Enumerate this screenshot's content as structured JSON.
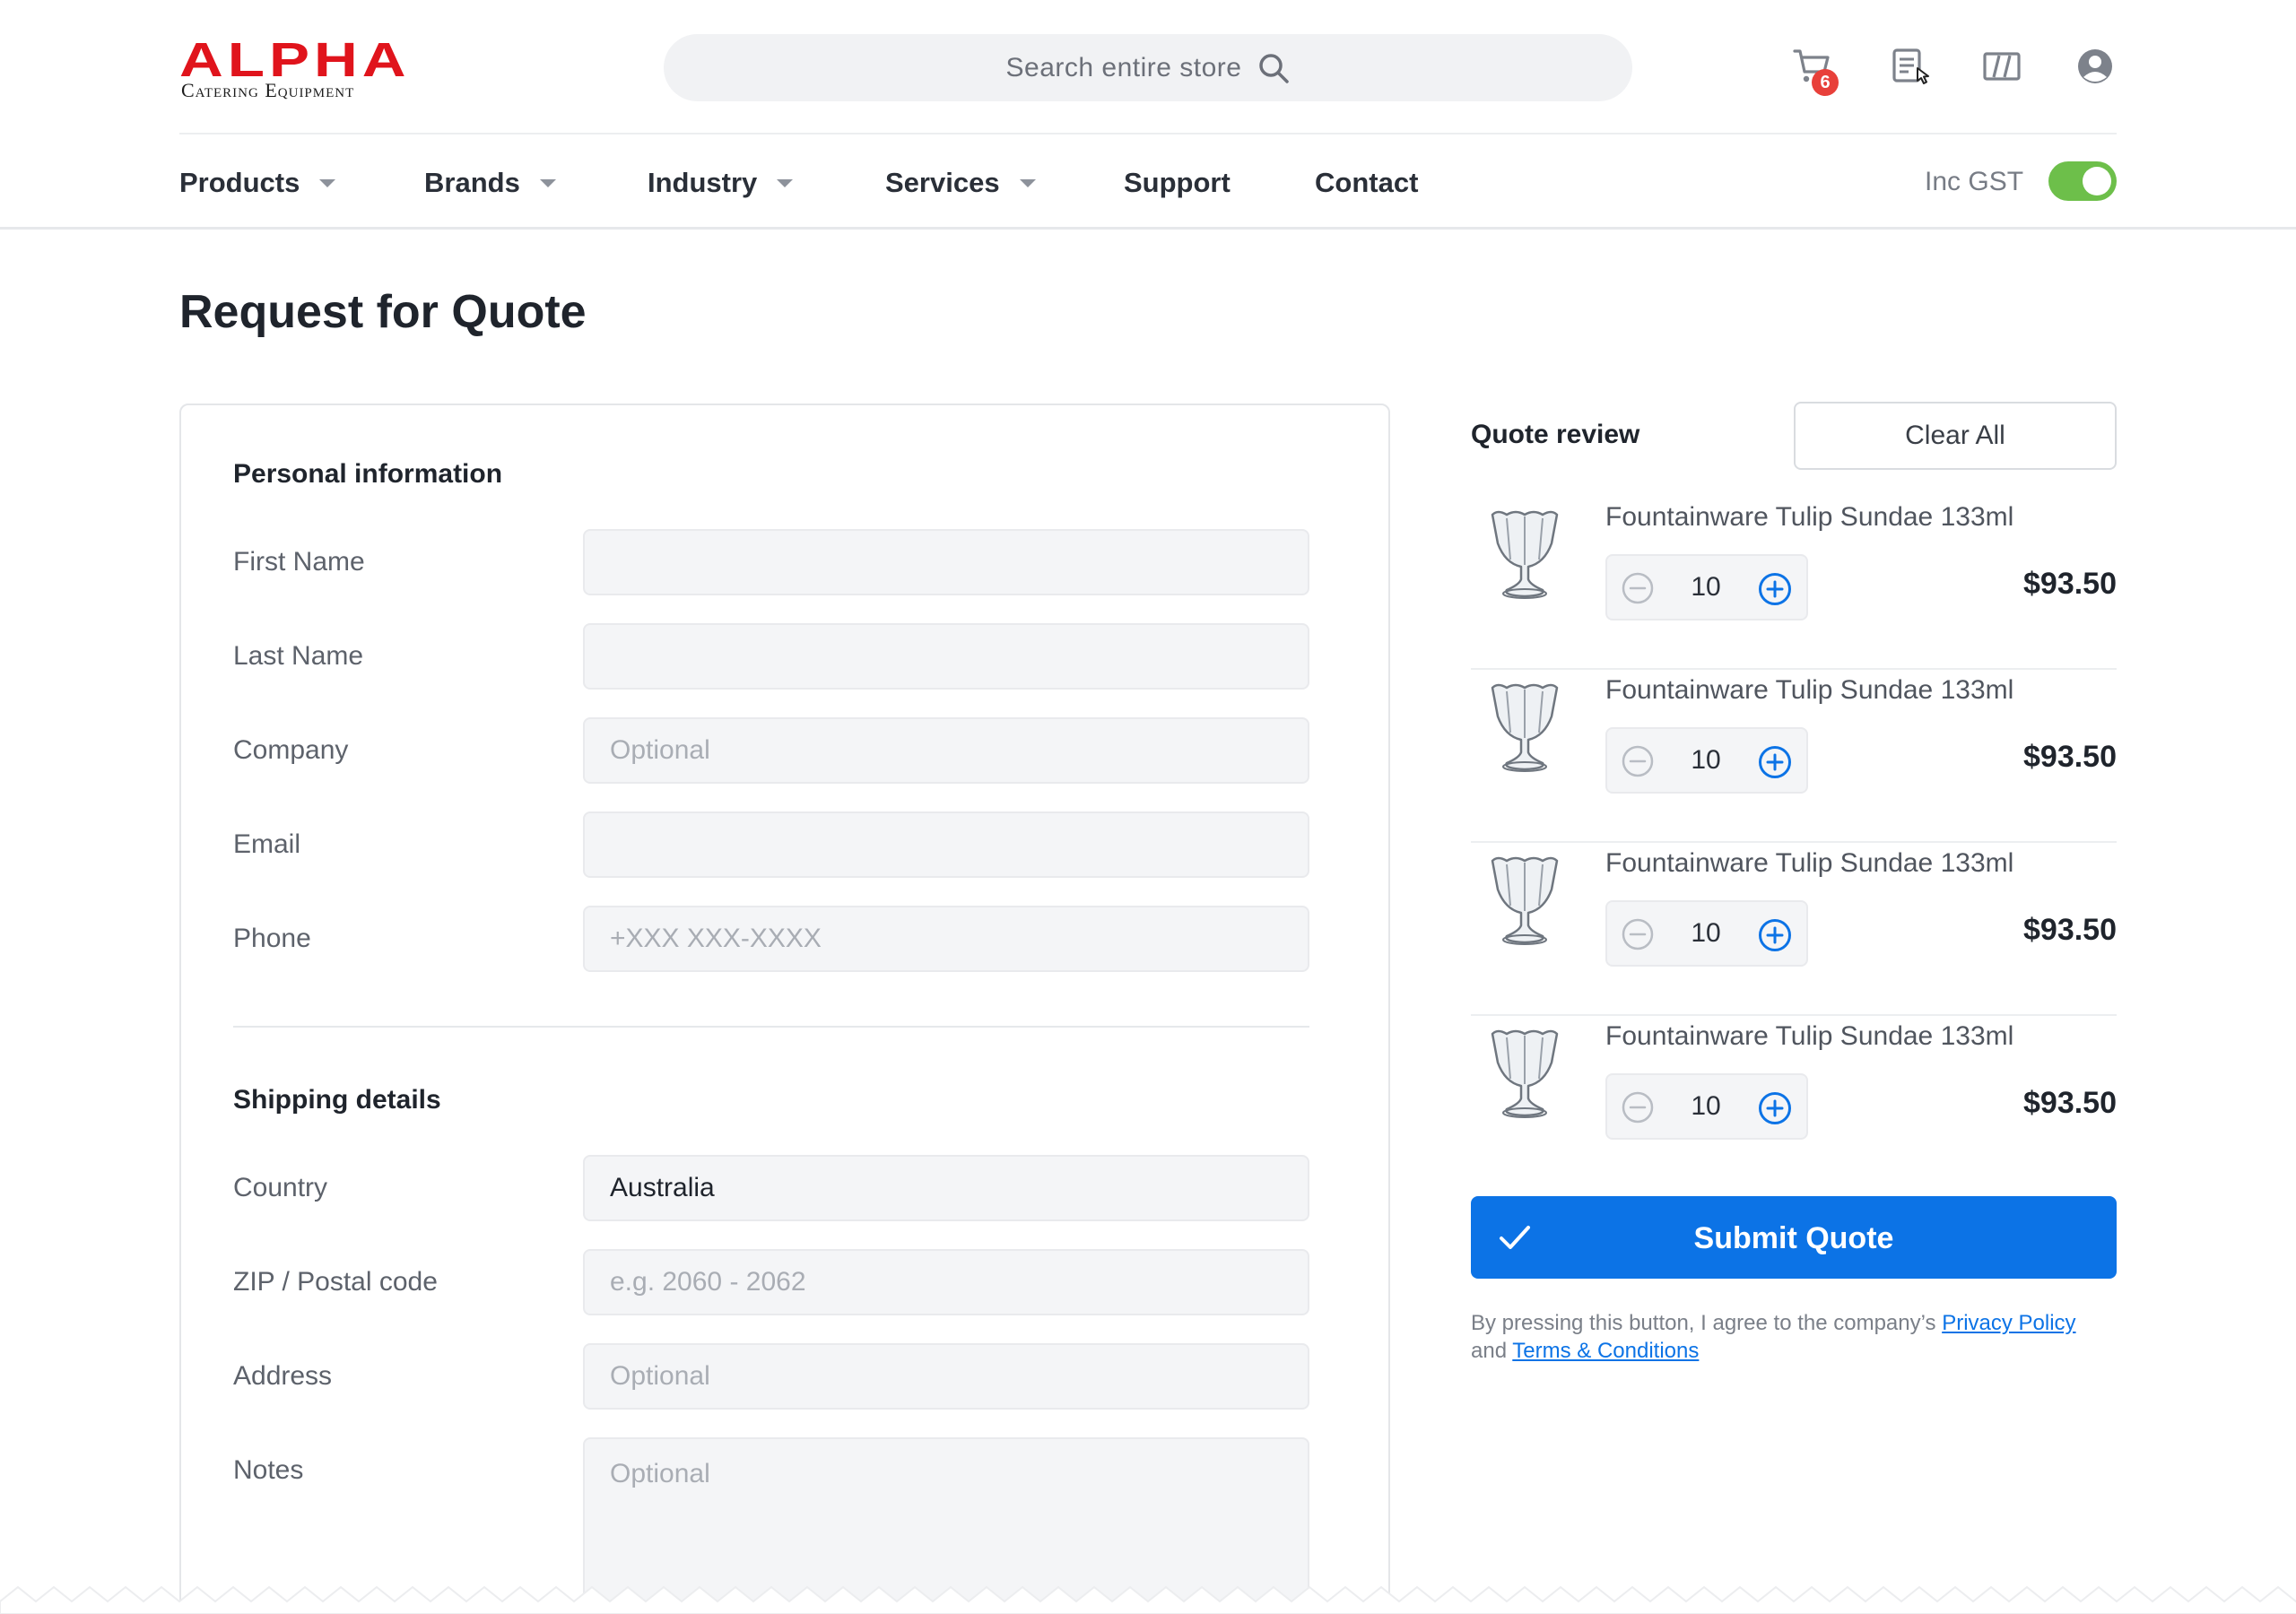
{
  "header": {
    "logo": {
      "title": "ALPHA",
      "subtitle": "Catering Equipment"
    },
    "search": {
      "placeholder": "Search entire store"
    },
    "cart_count": "6",
    "icons": [
      "cart-icon",
      "quote-list-icon",
      "compare-icon",
      "account-icon"
    ],
    "nav": {
      "items": [
        {
          "label": "Products",
          "dropdown": true
        },
        {
          "label": "Brands",
          "dropdown": true
        },
        {
          "label": "Industry",
          "dropdown": true
        },
        {
          "label": "Services",
          "dropdown": true
        },
        {
          "label": "Support",
          "dropdown": false
        },
        {
          "label": "Contact",
          "dropdown": false
        }
      ]
    },
    "gst": {
      "label": "Inc GST",
      "enabled": true
    }
  },
  "page": {
    "title": "Request for Quote"
  },
  "form": {
    "personal": {
      "title": "Personal information",
      "first_name": {
        "label": "First Name",
        "placeholder": "",
        "value": ""
      },
      "last_name": {
        "label": "Last Name",
        "placeholder": "",
        "value": ""
      },
      "company": {
        "label": "Company",
        "placeholder": "Optional",
        "value": ""
      },
      "email": {
        "label": "Email",
        "placeholder": "",
        "value": ""
      },
      "phone": {
        "label": "Phone",
        "placeholder": "+XXX XXX-XXXX",
        "value": ""
      }
    },
    "shipping": {
      "title": "Shipping details",
      "country": {
        "label": "Country",
        "placeholder": "",
        "value": "Australia"
      },
      "zip": {
        "label": "ZIP / Postal code",
        "placeholder": "e.g. 2060 - 2062",
        "value": ""
      },
      "address": {
        "label": "Address",
        "placeholder": "Optional",
        "value": ""
      },
      "notes": {
        "label": "Notes",
        "placeholder": "Optional",
        "value": ""
      }
    }
  },
  "quote": {
    "title": "Quote review",
    "clear_label": "Clear All",
    "items": [
      {
        "name": "Fountainware Tulip Sundae 133ml",
        "qty": "10",
        "price": "$93.50"
      },
      {
        "name": "Fountainware Tulip Sundae 133ml",
        "qty": "10",
        "price": "$93.50"
      },
      {
        "name": "Fountainware Tulip Sundae 133ml",
        "qty": "10",
        "price": "$93.50"
      },
      {
        "name": "Fountainware Tulip Sundae 133ml",
        "qty": "10",
        "price": "$93.50"
      }
    ],
    "submit_label": "Submit Quote",
    "terms": {
      "prefix": "By pressing this button, I agree to the company’s ",
      "privacy": "Privacy Policy",
      "and": " and ",
      "conditions": "Terms & Conditions"
    }
  },
  "colors": {
    "brand_red": "#e0141c",
    "accent_blue": "#0c73e6",
    "toggle_green": "#6dbf4a",
    "badge_red": "#e8403a"
  }
}
